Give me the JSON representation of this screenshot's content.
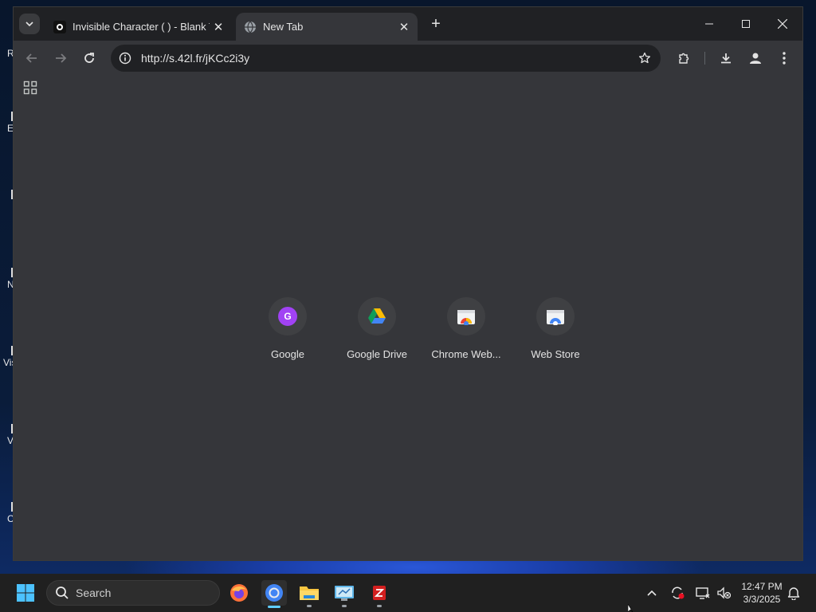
{
  "desktop": {
    "icon_labels": [
      "R",
      "E",
      "",
      "N",
      "Vis",
      "V",
      "C"
    ]
  },
  "browser": {
    "tabs": [
      {
        "title": "Invisible Character ( ) - Blank T",
        "active": false
      },
      {
        "title": "New Tab",
        "active": true
      }
    ],
    "address": {
      "url": "http://s.42l.fr/jKCc2i3y"
    },
    "shortcuts": [
      {
        "name": "Google",
        "icon": "google-icon",
        "letter": "G"
      },
      {
        "name": "Google Drive",
        "icon": "google-drive-icon"
      },
      {
        "name": "Chrome Web...",
        "icon": "chrome-web-store-icon"
      },
      {
        "name": "Web Store",
        "icon": "web-store-icon"
      }
    ],
    "colors": {
      "frame": "#202124",
      "toolbar": "#35363a",
      "accent_google": "#a142f4"
    }
  },
  "taskbar": {
    "search_label": "Search",
    "time": "12:47 PM",
    "date": "3/3/2025"
  }
}
